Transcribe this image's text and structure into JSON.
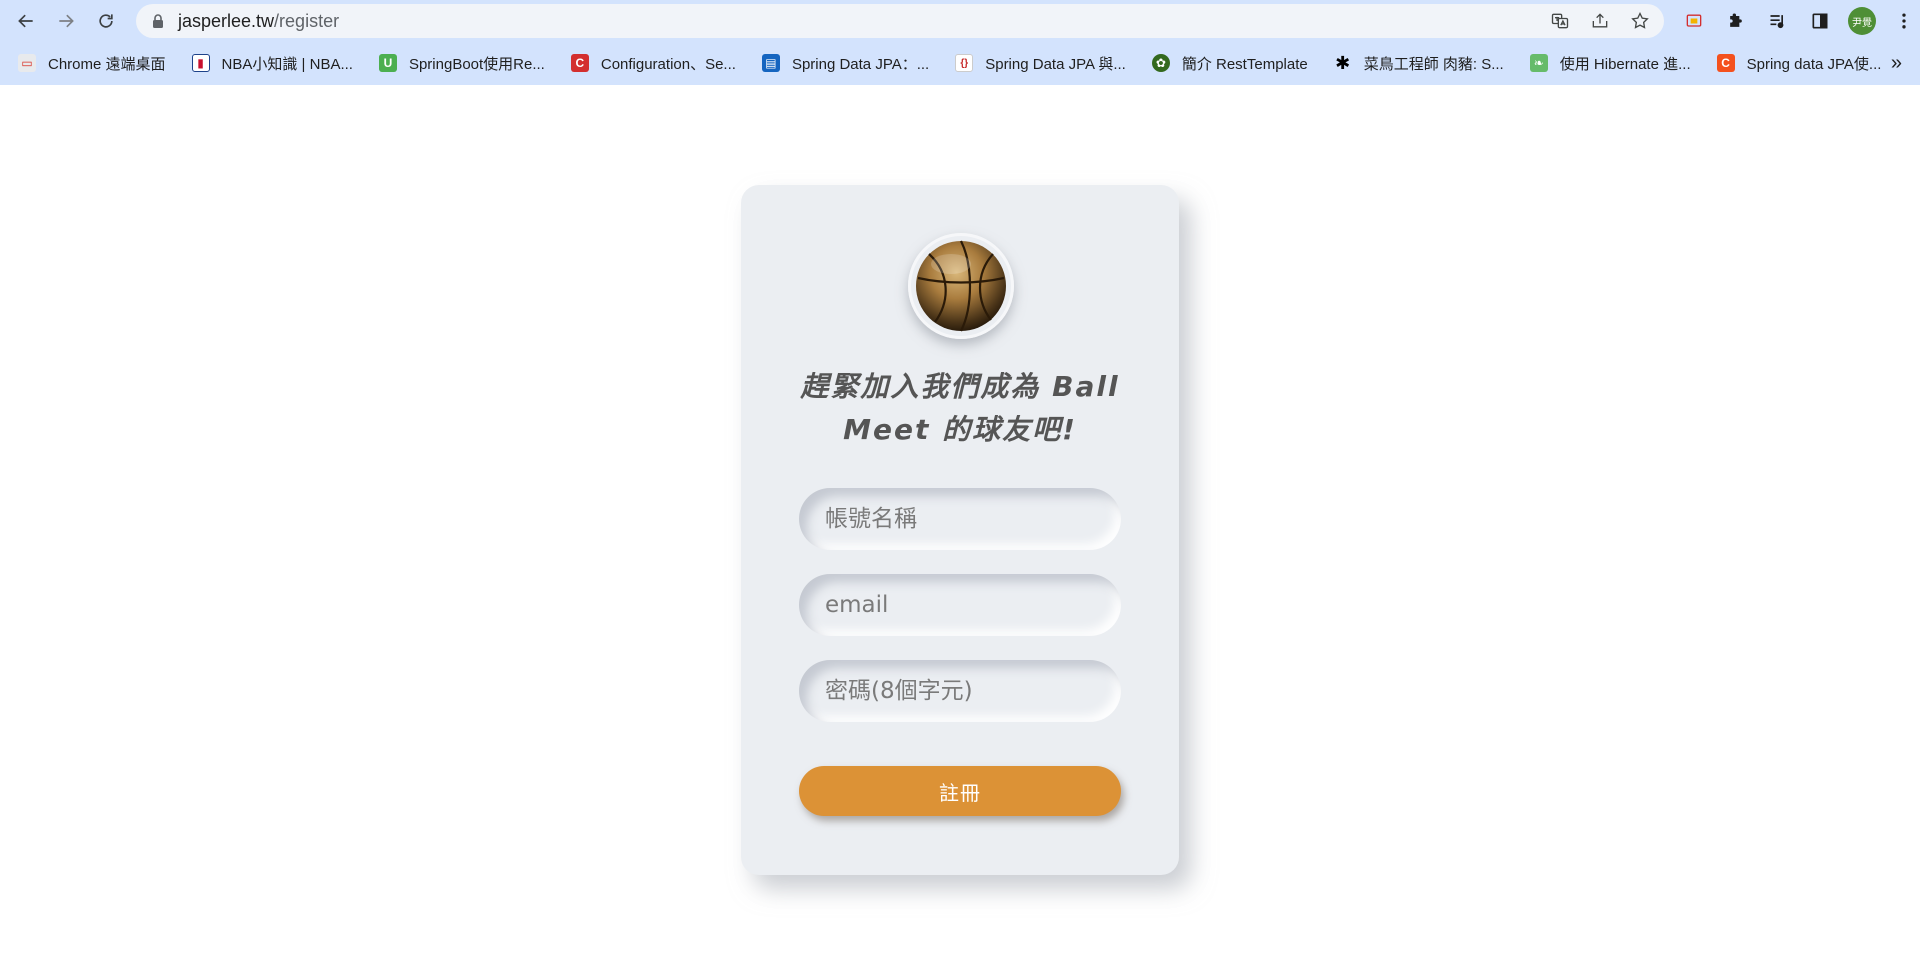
{
  "browser": {
    "url_host": "jasperlee.tw",
    "url_path": "/register",
    "profile_avatar_text": "尹覺",
    "bookmarks": [
      {
        "label": "Chrome 遠端桌面",
        "icon": "chrome-remote-desktop-icon",
        "color": "#e8eaed"
      },
      {
        "label": "NBA小知識 | NBA...",
        "icon": "nba-logo-icon",
        "color": "#1d428a"
      },
      {
        "label": "SpringBoot使用Re...",
        "icon": "green-u-icon",
        "color": "#4caf50"
      },
      {
        "label": "Configuration、Se...",
        "icon": "red-c-icon",
        "color": "#d32f2f"
      },
      {
        "label": "Spring Data JPA：...",
        "icon": "blue-doc-icon",
        "color": "#1565c0"
      },
      {
        "label": "Spring Data JPA 與...",
        "icon": "braces-icon",
        "color": "#c62828"
      },
      {
        "label": "簡介 RestTemplate",
        "icon": "leaf-badge-icon",
        "color": "#33691e"
      },
      {
        "label": "菜鳥工程師 肉豬: S...",
        "icon": "star-burst-icon",
        "color": "#000000"
      },
      {
        "label": "使用 Hibernate 進...",
        "icon": "green-leaf-icon",
        "color": "#66bb6a"
      },
      {
        "label": "Spring data JPA使...",
        "icon": "orange-c-icon",
        "color": "#f4511e"
      }
    ],
    "more_label": "»"
  },
  "register": {
    "headline": "趕緊加入我們成為 Ball Meet 的球友吧!",
    "username_placeholder": "帳號名稱",
    "email_placeholder": "email",
    "password_placeholder": "密碼(8個字元)",
    "submit_label": "註冊",
    "logo_icon": "basketball-icon",
    "accent_color": "#dc9236"
  }
}
